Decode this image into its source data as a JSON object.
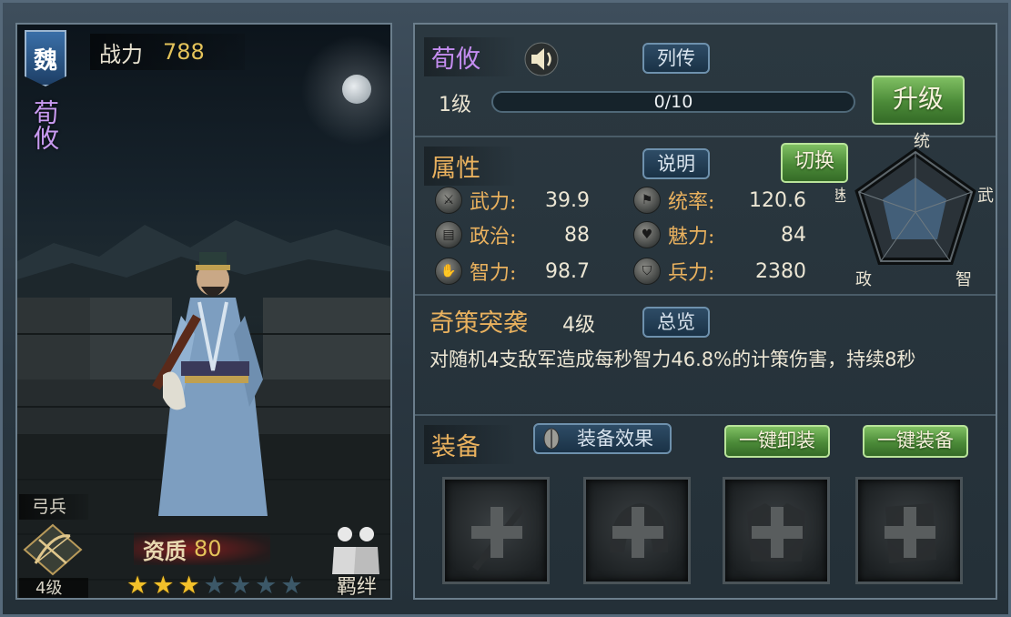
{
  "hero": {
    "kingdom_badge": "魏",
    "name": "荀攸",
    "power_label": "战力",
    "power_value": "788",
    "unit_type": "弓兵",
    "unit_level": "4级",
    "aptitude_label": "资质",
    "aptitude_value": "80",
    "stars_filled": 3,
    "stars_total": 7,
    "bond_label": "羁绊"
  },
  "info": {
    "hero_name": "荀攸",
    "biography_button": "列传",
    "level_text": "1级",
    "exp_text": "0/10",
    "exp_progress": 0,
    "upgrade_button": "升级",
    "attributes_title": "属性",
    "explain_button": "说明",
    "switch_button": "切换",
    "attributes": [
      {
        "label": "武力:",
        "value": "39.9",
        "icon": "sword-icon"
      },
      {
        "label": "统率:",
        "value": "120.6",
        "icon": "flag-icon"
      },
      {
        "label": "政治:",
        "value": "88",
        "icon": "scroll-icon"
      },
      {
        "label": "魅力:",
        "value": "84",
        "icon": "heart-icon"
      },
      {
        "label": "智力:",
        "value": "98.7",
        "icon": "hand-icon"
      },
      {
        "label": "兵力:",
        "value": "2380",
        "icon": "shield-icon"
      }
    ],
    "radar_labels": {
      "top": "统",
      "right": "武",
      "bottom_right": "智",
      "bottom_left": "政",
      "left": "魅"
    },
    "skill_name": "奇策突袭",
    "skill_level": "4级",
    "overview_button": "总览",
    "skill_description": "对随机4支敌军造成每秒智力46.8%的计策伤害，持续8秒",
    "equipment_title": "装备",
    "equip_effect_button": "装备效果",
    "unequip_all_button": "一键卸装",
    "equip_all_button": "一键装备",
    "slots": [
      "weapon-slot",
      "helmet-slot",
      "armor-slot",
      "book-slot"
    ]
  }
}
